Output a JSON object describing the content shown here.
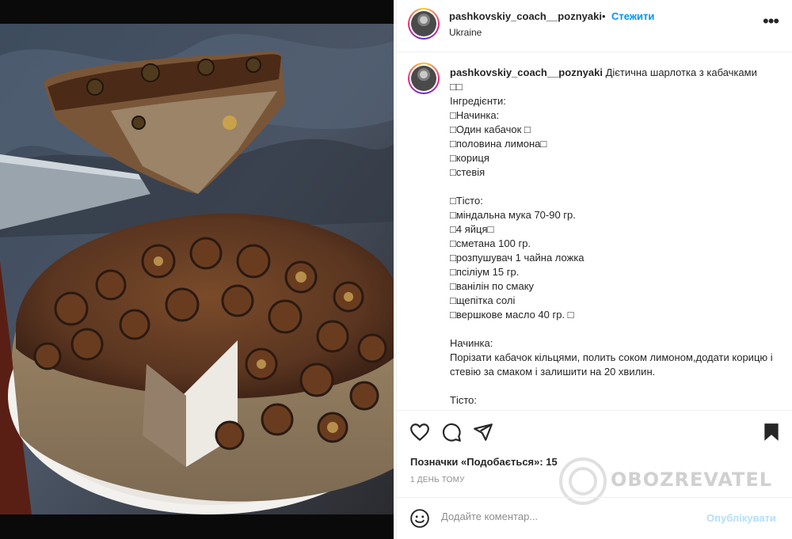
{
  "header": {
    "username": "pashkovskiy_coach__poznyaki",
    "separator": "•",
    "follow_label": "Стежити",
    "location": "Ukraine",
    "more_glyph": "•••"
  },
  "caption": {
    "username": "pashkovskiy_coach__poznyaki",
    "title": "Дієтична шарлотка з кабачками",
    "lines": [
      "□□",
      "Інгредієнти:",
      "□Начинка:",
      "□Один кабачок □",
      "□половина лимона□",
      "□кориця",
      "□стевія",
      "",
      "□Тісто:",
      "□міндальна мука 70-90 гр.",
      "□4 яйця□",
      "□сметана 100 гр.",
      "□розпушувач 1 чайна ложка",
      "□псіліум 15 гр.",
      "□ванілін по смаку",
      "□щепітка солі",
      "□вершкове масло 40 гр. □",
      "",
      "Начинка:",
      "Порізати кабачок кільцями, полить соком лимоном,додати корицю і стевію за смаком і залишити на 20 хвилин.",
      "",
      "Тісто:"
    ]
  },
  "actions": {
    "like_icon": "heart-icon",
    "comment_icon": "comment-icon",
    "share_icon": "share-icon",
    "save_icon": "bookmark-icon",
    "likes_text": "Позначки «Подобається»: 15",
    "time_text": "1 ДЕНЬ ТОМУ"
  },
  "watermark": {
    "text": "OBOZREVATEL"
  },
  "comment": {
    "placeholder": "Додайте коментар...",
    "publish_label": "Опублікувати",
    "emoji_icon": "emoji-icon"
  },
  "colors": {
    "follow_blue": "#0095f6",
    "publish_disabled": "#b2dffc",
    "muted": "#8e8e8e",
    "text": "#262626"
  }
}
